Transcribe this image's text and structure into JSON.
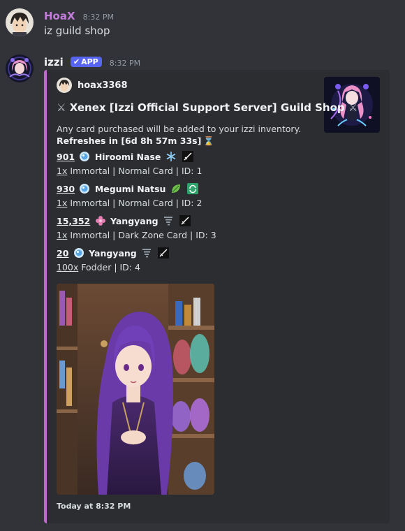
{
  "messages": [
    {
      "username": "HoaX",
      "username_color": "#c27cd9",
      "time": "8:32 PM",
      "text": "iz guild shop"
    },
    {
      "username": "izzi",
      "username_color": "#f2f3f5",
      "badge": "APP",
      "time": "8:32 PM"
    }
  ],
  "embed": {
    "accent": "#c06ad0",
    "author": "hoax3368",
    "title": "Xenex [Izzi Official Support Server] Guild Shop",
    "title_icon": "crossed-swords-icon",
    "description_line1": "Any card purchased will be added to your izzi inventory.",
    "refresh_label": "Refreshes in [6d 8h 57m 33s]",
    "refresh_icon": "hourglass-icon",
    "items": [
      {
        "price": "901",
        "currency_icon": "orb-icon",
        "name": "Hiroomi Nase",
        "element_icon": "snowflake-icon",
        "class_icon": "sword-icon",
        "qty": "1x",
        "details": "Immortal | Normal Card | ID: 1"
      },
      {
        "price": "930",
        "currency_icon": "orb-icon",
        "name": "Megumi Natsu",
        "element_icon": "leaf-icon",
        "class_icon": "refresh-icon",
        "qty": "1x",
        "details": "Immortal | Normal Card | ID: 2"
      },
      {
        "price": "15,352",
        "currency_icon": "pink-gem-icon",
        "name": "Yangyang",
        "element_icon": "tornado-icon",
        "class_icon": "sword-icon",
        "qty": "1x",
        "details": "Immortal | Dark Zone Card | ID: 3"
      },
      {
        "price": "20",
        "currency_icon": "orb-icon",
        "name": "Yangyang",
        "element_icon": "tornado-icon",
        "class_icon": "sword-icon",
        "qty": "100x",
        "details": "Fodder | ID: 4"
      }
    ],
    "footer": "Today at 8:32 PM"
  }
}
